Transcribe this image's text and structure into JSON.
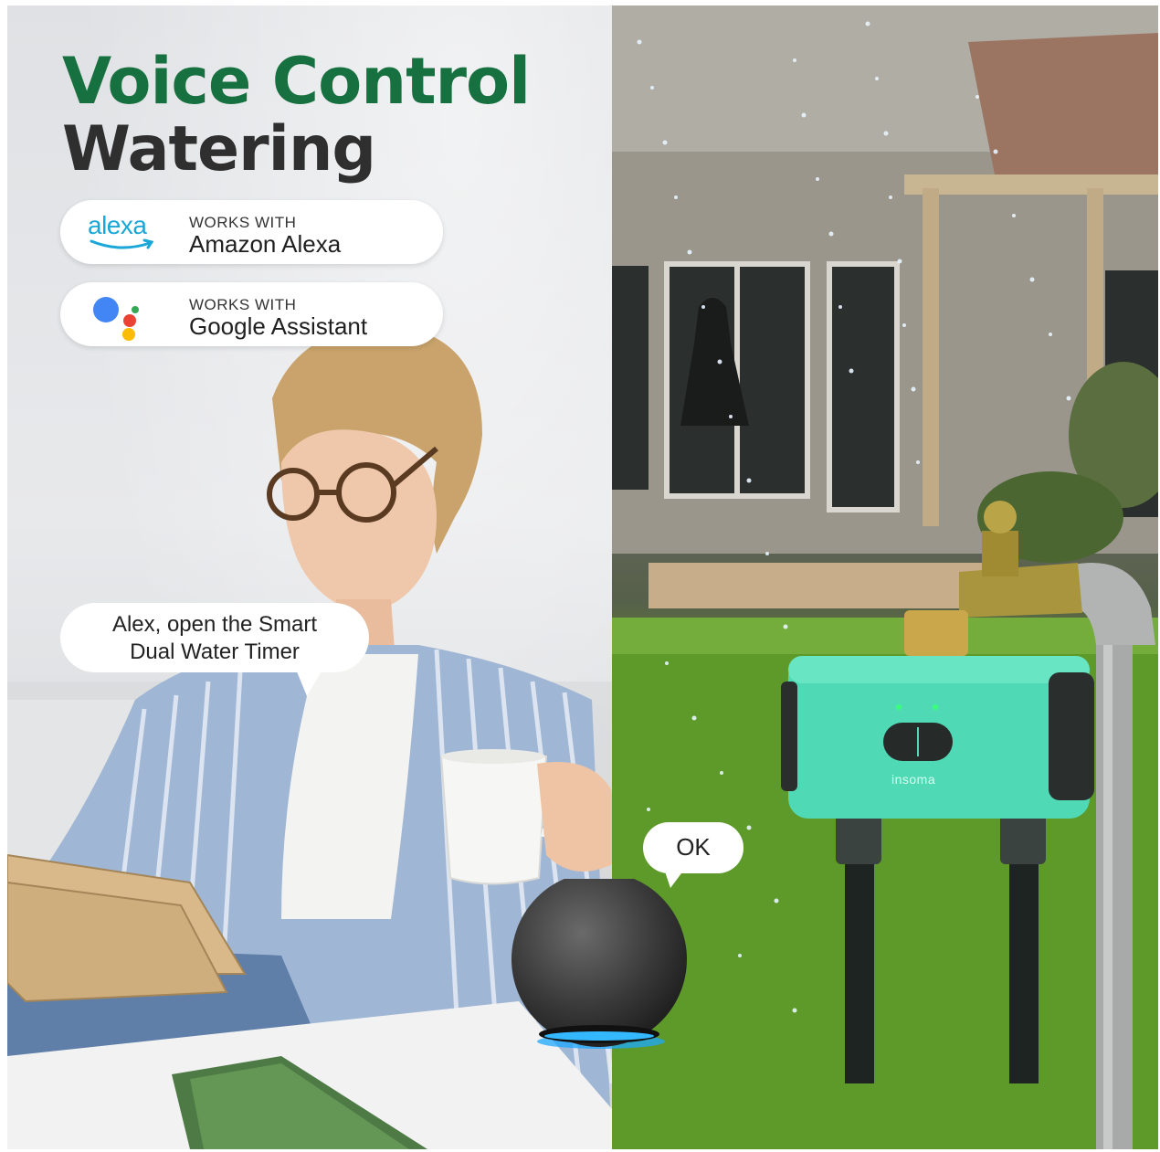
{
  "headline": {
    "line1": "Voice Control",
    "line2": "Watering"
  },
  "badges": [
    {
      "logo_text": "alexa",
      "small": "WORKS WITH",
      "big": "Amazon Alexa",
      "logo_icon": "alexa-logo-icon"
    },
    {
      "small": "WORKS WITH",
      "big": "Google Assistant",
      "logo_icon": "google-assistant-logo-icon"
    }
  ],
  "speech": {
    "command_line1": "Alex, open the Smart",
    "command_line2": "Dual Water Timer",
    "reply": "OK"
  },
  "device": {
    "brand": "insoma"
  },
  "colors": {
    "headline_green": "#17703f",
    "headline_dark": "#2f2f2f",
    "device_teal": "#4fd9b4",
    "alexa_blue": "#1aa7d8"
  }
}
